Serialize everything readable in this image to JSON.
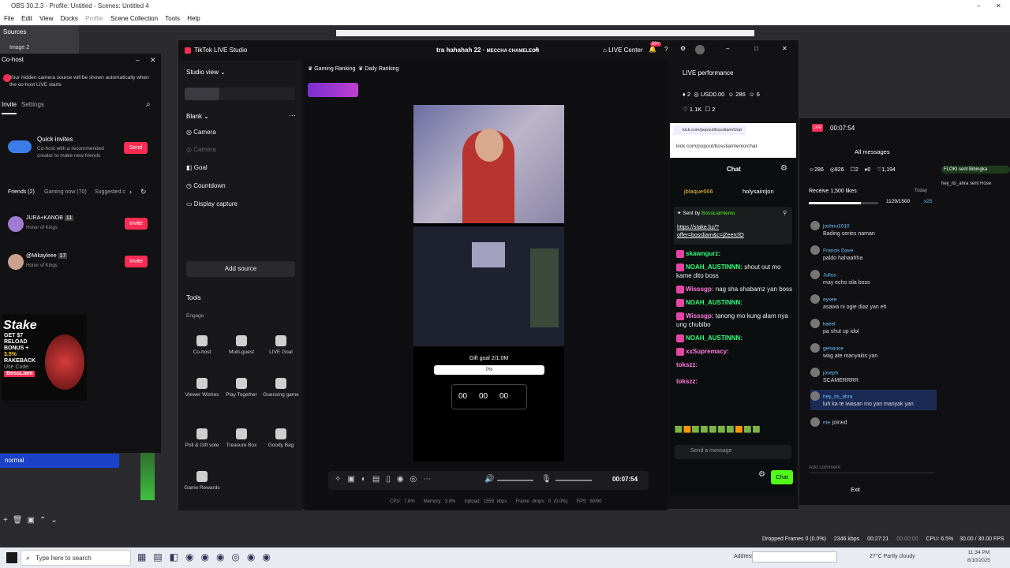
{
  "obs": {
    "title": "OBS 30.2.3 - Profile: Untitled - Scenes: Untitled 4",
    "menu": [
      "File",
      "Edit",
      "View",
      "Docks",
      "Profile",
      "Scene Collection",
      "Tools",
      "Help"
    ],
    "sources_label": "Sources",
    "source_item": "Image 2",
    "scene_item": "normal",
    "status": {
      "dropped": "Dropped Frames 0 (0.0%)",
      "kbps": "2346 kbps",
      "time1": "00:27:21",
      "time2": "00:00:00",
      "cpu": "CPU: 6.5%",
      "fps": "30.00 / 30.00 FPS"
    }
  },
  "cohost": {
    "title": "Co-host",
    "notice": "Your hidden camera source will be shown automatically when the co-host LIVE starts",
    "tabs": [
      "Invite",
      "Settings"
    ],
    "quick_title": "Quick invites",
    "quick_desc": "Co-host with a recommended creator to make new friends",
    "send": "Send",
    "filters": [
      "Friends (2)",
      "Gaming now (70)",
      "Suggested c"
    ],
    "people": [
      {
        "name": "JURA+KANOB",
        "level": "11",
        "game": "Honor of Kings",
        "btn": "Invite"
      },
      {
        "name": "@Mikayleee",
        "level": "17",
        "game": "Honor of Kings",
        "btn": "Invite"
      }
    ]
  },
  "ad": {
    "brand": "Stake",
    "line1": "GET $7",
    "line2": "RELOAD",
    "line3": "BONUS +",
    "line4": "3.5%",
    "line5": "RAKEBACK",
    "code_label": "Use Code:",
    "code": "BossLiam"
  },
  "tiktok": {
    "app_title": "TikTok LIVE Studio",
    "stream_title": "tra hahahah 22",
    "stream_sub": "MECCHA CHAMELEON",
    "live_center": "LIVE Center",
    "notif_count": "99+",
    "studio_view": "Studio view",
    "scene_name": "Blank",
    "sources": [
      "Camera",
      "Camera",
      "Goal",
      "Countdown",
      "Display capture"
    ],
    "add_source": "Add source",
    "tools_title": "Tools",
    "engage": "Engage",
    "tools": [
      {
        "label": "Co-host",
        "icon": "cohost-icon"
      },
      {
        "label": "Multi-guest",
        "icon": "multiguest-icon"
      },
      {
        "label": "LIVE Goal",
        "icon": "goal-icon"
      },
      {
        "label": "Viewer Wishes",
        "icon": "gift-icon"
      },
      {
        "label": "Play Together",
        "icon": "game-icon"
      },
      {
        "label": "Guessing game",
        "icon": "question-icon"
      },
      {
        "label": "Poll & Gift vote",
        "icon": "poll-icon"
      },
      {
        "label": "Treasure Box",
        "icon": "box-icon"
      },
      {
        "label": "Goody Bag",
        "icon": "bag-icon"
      },
      {
        "label": "Game Rewards",
        "icon": "reward-icon"
      }
    ],
    "gaming_ranking": "Gaming Ranking",
    "daily_ranking": "Daily Ranking",
    "gift_goal": "Gift goal 2/1.0M",
    "gift_pct": "0%",
    "countdown": [
      "00",
      "00",
      "00"
    ],
    "timer": "00:07:54",
    "perf_title": "LIVE performance",
    "perf": {
      "a": "2",
      "usd": "USD0.00",
      "viewers": "286",
      "c": "6",
      "likes": "1.1K",
      "d": "2"
    },
    "footer": {
      "cpu": "CPU: 7.8%",
      "mem": "Memory: 3.8%",
      "upload": "Upload: 1559 kbps",
      "drops": "Frame drops: 0 (0.0%)",
      "fps": "FPS: 60/60"
    }
  },
  "kick": {
    "url": "kick.com/popout/bossliamlenio/chat",
    "chat_title": "Chat",
    "top_users": [
      "jblaque666",
      "holysaintjon"
    ],
    "pinned_by": "Sent by",
    "pinned_user": "BossLiamlenio",
    "pinned_link": "https://stake.bz/?offer=bossliam&c=jZeercfO",
    "messages": [
      {
        "user": "skawngurz:",
        "text": ""
      },
      {
        "user": "NOAH_AUSTINNN:",
        "text": "shout out mo kame dito boss"
      },
      {
        "user": "Wisssgp:",
        "text": "nag sha shabamz yan boss"
      },
      {
        "user": "NOAH_AUSTINNN:",
        "text": ""
      },
      {
        "user": "Wisssgp:",
        "text": "tanong mo kung alam nya ung chubibo"
      },
      {
        "user": "NOAH_AUSTINNN:",
        "text": ""
      },
      {
        "user": "xxSupremacy:",
        "text": ""
      },
      {
        "user": "tokszz:",
        "text": ""
      },
      {
        "user": "tokszz:",
        "text": ""
      }
    ],
    "send_placeholder": "Send a message",
    "chat_btn": "Chat"
  },
  "tt_chat": {
    "live_time": "00:07:54",
    "all_messages": "All messages",
    "stats": [
      "286",
      "826",
      "2",
      "6",
      "1,194"
    ],
    "goal": "Receive 1,500 likes",
    "today": "Today",
    "progress": "1129/1500",
    "progress_frac": 0.75,
    "x25": "x25",
    "messages": [
      {
        "name": "joshnu1010",
        "text": "Bading series naman"
      },
      {
        "name": "Francis Dave",
        "text": "paldo hahaahha"
      },
      {
        "name": "Julius",
        "text": "may echo sila boss"
      },
      {
        "name": "eysee",
        "text": "asawa ni ogie diaz yan eh"
      },
      {
        "name": "kaeel",
        "text": "pa shut up idol"
      },
      {
        "name": "gelsauce",
        "text": "wag ate manyakis yan"
      },
      {
        "name": "joseph",
        "text": "SCAMERRRR"
      },
      {
        "name": "hey_its_ahra",
        "text": "luh ka te iwasan mo yan manyak yan"
      },
      {
        "name": "me",
        "text": "joined"
      }
    ],
    "add_comment": "Add comment",
    "exit": "Exit",
    "gifts": [
      "FLOKI sent Bibingka",
      "hey_its_ahra sent Rose"
    ]
  },
  "taskbar": {
    "search": "Type here to search",
    "address": "Address",
    "weather": "27°C  Partly cloudy",
    "time": "11:34 PM",
    "date": "8/10/2025"
  }
}
